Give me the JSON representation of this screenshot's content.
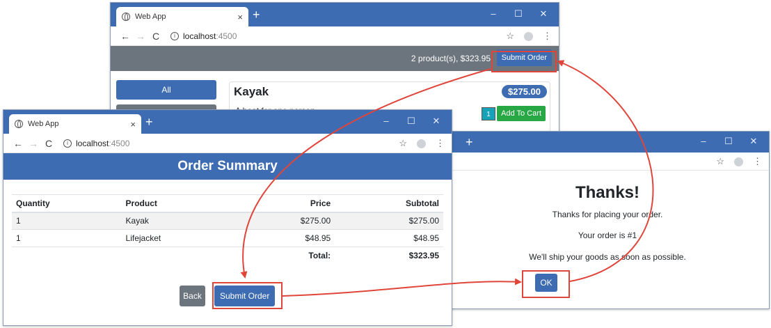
{
  "browser": {
    "tab_title": "Web App",
    "tab_close": "×",
    "new_tab": "+",
    "url_host": "localhost",
    "url_port": ":4500",
    "back": "←",
    "forward": "→",
    "reload": "C",
    "info": "i",
    "star": "☆",
    "menu": "⋮",
    "minimize": "–",
    "maximize": "☐",
    "close": "✕"
  },
  "store_window": {
    "cart_summary": "2 product(s), $323.95",
    "submit_order": "Submit Order",
    "categories": [
      "All",
      ""
    ],
    "product": {
      "name": "Kayak",
      "price": "$275.00",
      "description": "A boat for one person",
      "quantity": "1",
      "add_to_cart": "Add To Cart"
    }
  },
  "summary_window": {
    "header": "Order Summary",
    "columns": [
      "Quantity",
      "Product",
      "Price",
      "Subtotal"
    ],
    "rows": [
      {
        "quantity": "1",
        "product": "Kayak",
        "price": "$275.00",
        "subtotal": "$275.00"
      },
      {
        "quantity": "1",
        "product": "Lifejacket",
        "price": "$48.95",
        "subtotal": "$48.95"
      }
    ],
    "total_label": "Total:",
    "total_value": "$323.95",
    "back_button": "Back",
    "submit_button": "Submit Order"
  },
  "thanks_window": {
    "title": "Thanks!",
    "line1": "Thanks for placing your order.",
    "line2": "Your order is #1",
    "line3": "We'll ship your goods as soon as possible.",
    "ok_button": "OK"
  },
  "colors": {
    "primary": "#3d6cb3",
    "secondary": "#6c757d",
    "success": "#28a745",
    "info": "#17a2b8",
    "highlight": "#e0453a"
  }
}
